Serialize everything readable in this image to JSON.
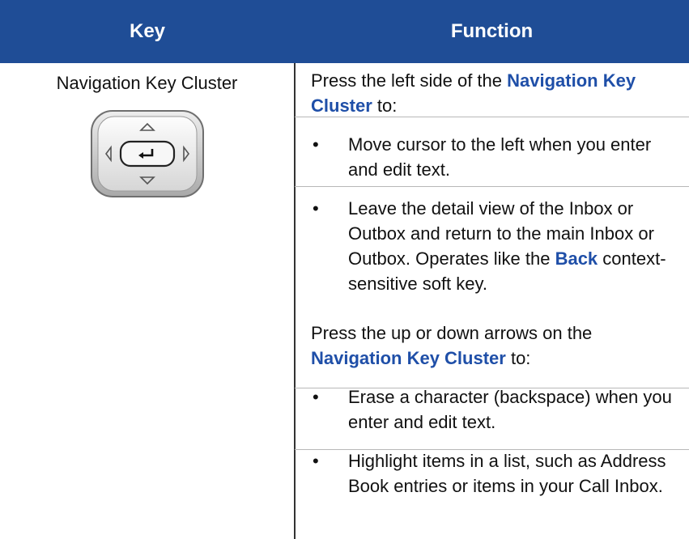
{
  "header": {
    "key_label": "Key",
    "function_label": "Function",
    "background_color": "#1f4d96"
  },
  "row": {
    "key_name": "Navigation Key Cluster",
    "key_image_icon": "navigation-key-cluster-icon",
    "intro1": {
      "before": "Press the left side of the ",
      "highlight": "Navigation Key Cluster",
      "after": " to:"
    },
    "bullets1": [
      {
        "text": "Move cursor to the left when you enter and edit text."
      },
      {
        "text_before": "Leave the detail view of the Inbox or Outbox and return to the main Inbox or Outbox. Operates like the ",
        "highlight": "Back",
        "text_after": " context-sensitive soft key."
      }
    ],
    "intro2": {
      "before": "Press the up or down arrows on the ",
      "highlight": "Navigation Key Cluster",
      "after": " to:"
    },
    "bullets2": [
      {
        "text": "Erase a character (backspace) when you enter and edit text."
      },
      {
        "text": "Highlight items in a list, such as Address Book entries or items in your Call Inbox."
      }
    ],
    "bullet_char": "•",
    "highlight_color": "#1f4fa8"
  }
}
